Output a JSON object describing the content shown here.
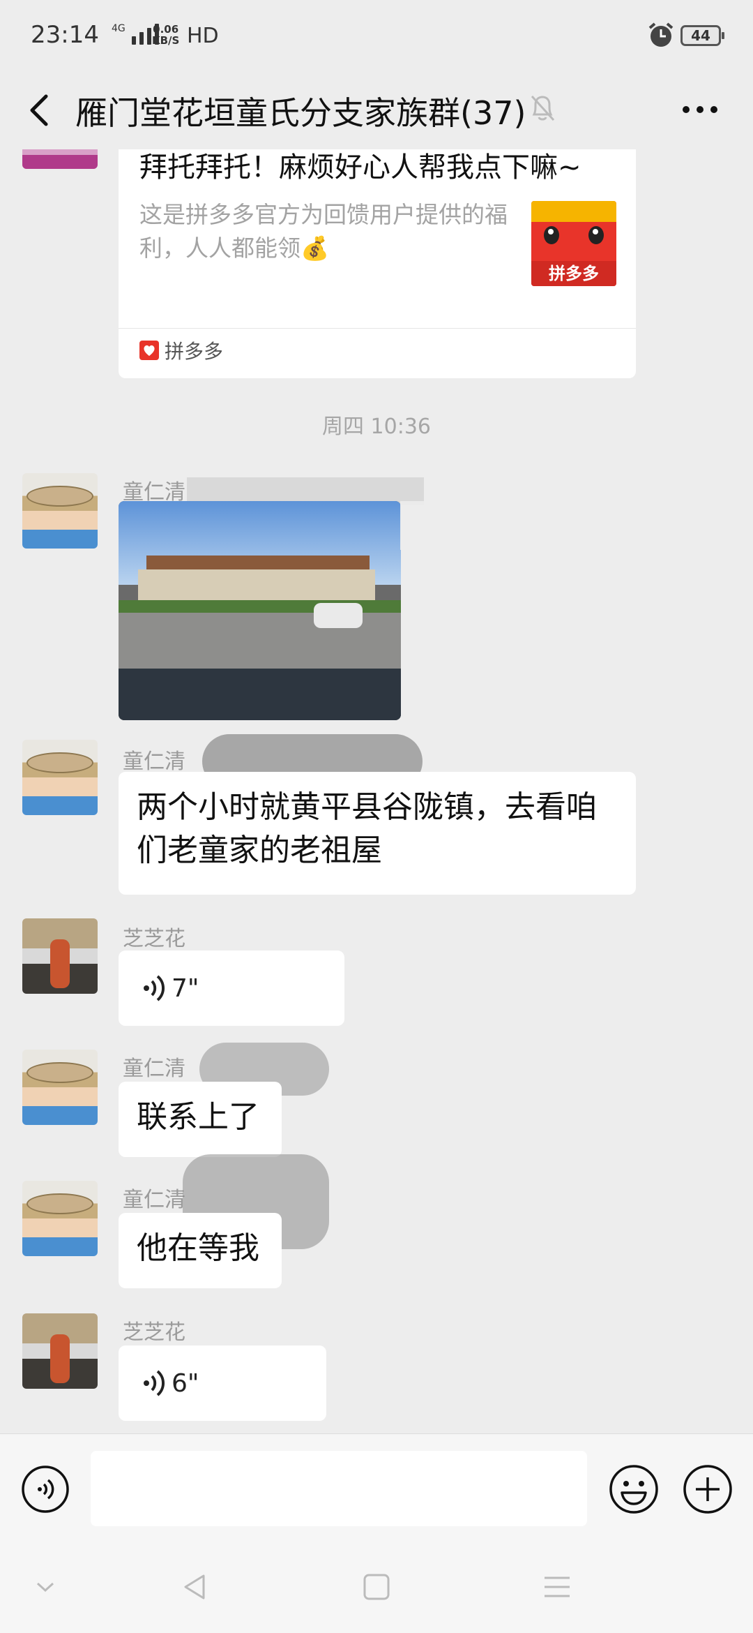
{
  "status_bar": {
    "time": "23:14",
    "network": "4G",
    "speed_value": "0.06",
    "speed_unit": "KB/S",
    "hd": "HD",
    "battery": "44"
  },
  "header": {
    "title": "雁门堂花垣童氏分支家族群(37)"
  },
  "link_card": {
    "title": "拜托拜托！麻烦好心人帮我点下嘛~",
    "description": "这是拼多多官方为回馈用户提供的福利，人人都能领💰",
    "thumb_label": "拼多多",
    "source": "拼多多"
  },
  "timestamp": "周四 10:36",
  "messages": [
    {
      "sender": "童仁清",
      "type": "image"
    },
    {
      "sender": "童仁清",
      "type": "text",
      "text": "两个小时就黄平县谷陇镇，去看咱们老童家的老祖屋"
    },
    {
      "sender": "芝芝花",
      "type": "voice",
      "duration": "7\""
    },
    {
      "sender": "童仁清",
      "type": "text",
      "text": "联系上了"
    },
    {
      "sender": "童仁清",
      "type": "text",
      "text": "他在等我"
    },
    {
      "sender": "芝芝花",
      "type": "voice",
      "duration": "6\""
    }
  ],
  "input": {
    "placeholder": ""
  },
  "icons": {
    "back": "back-arrow-icon",
    "mute": "mute-bell-icon",
    "more": "more-dots-icon",
    "voice": "voice-icon",
    "emoji": "emoji-icon",
    "plus": "plus-icon"
  },
  "colors": {
    "background": "#ededed",
    "bubble": "#ffffff",
    "pdd_red": "#e8342a"
  }
}
